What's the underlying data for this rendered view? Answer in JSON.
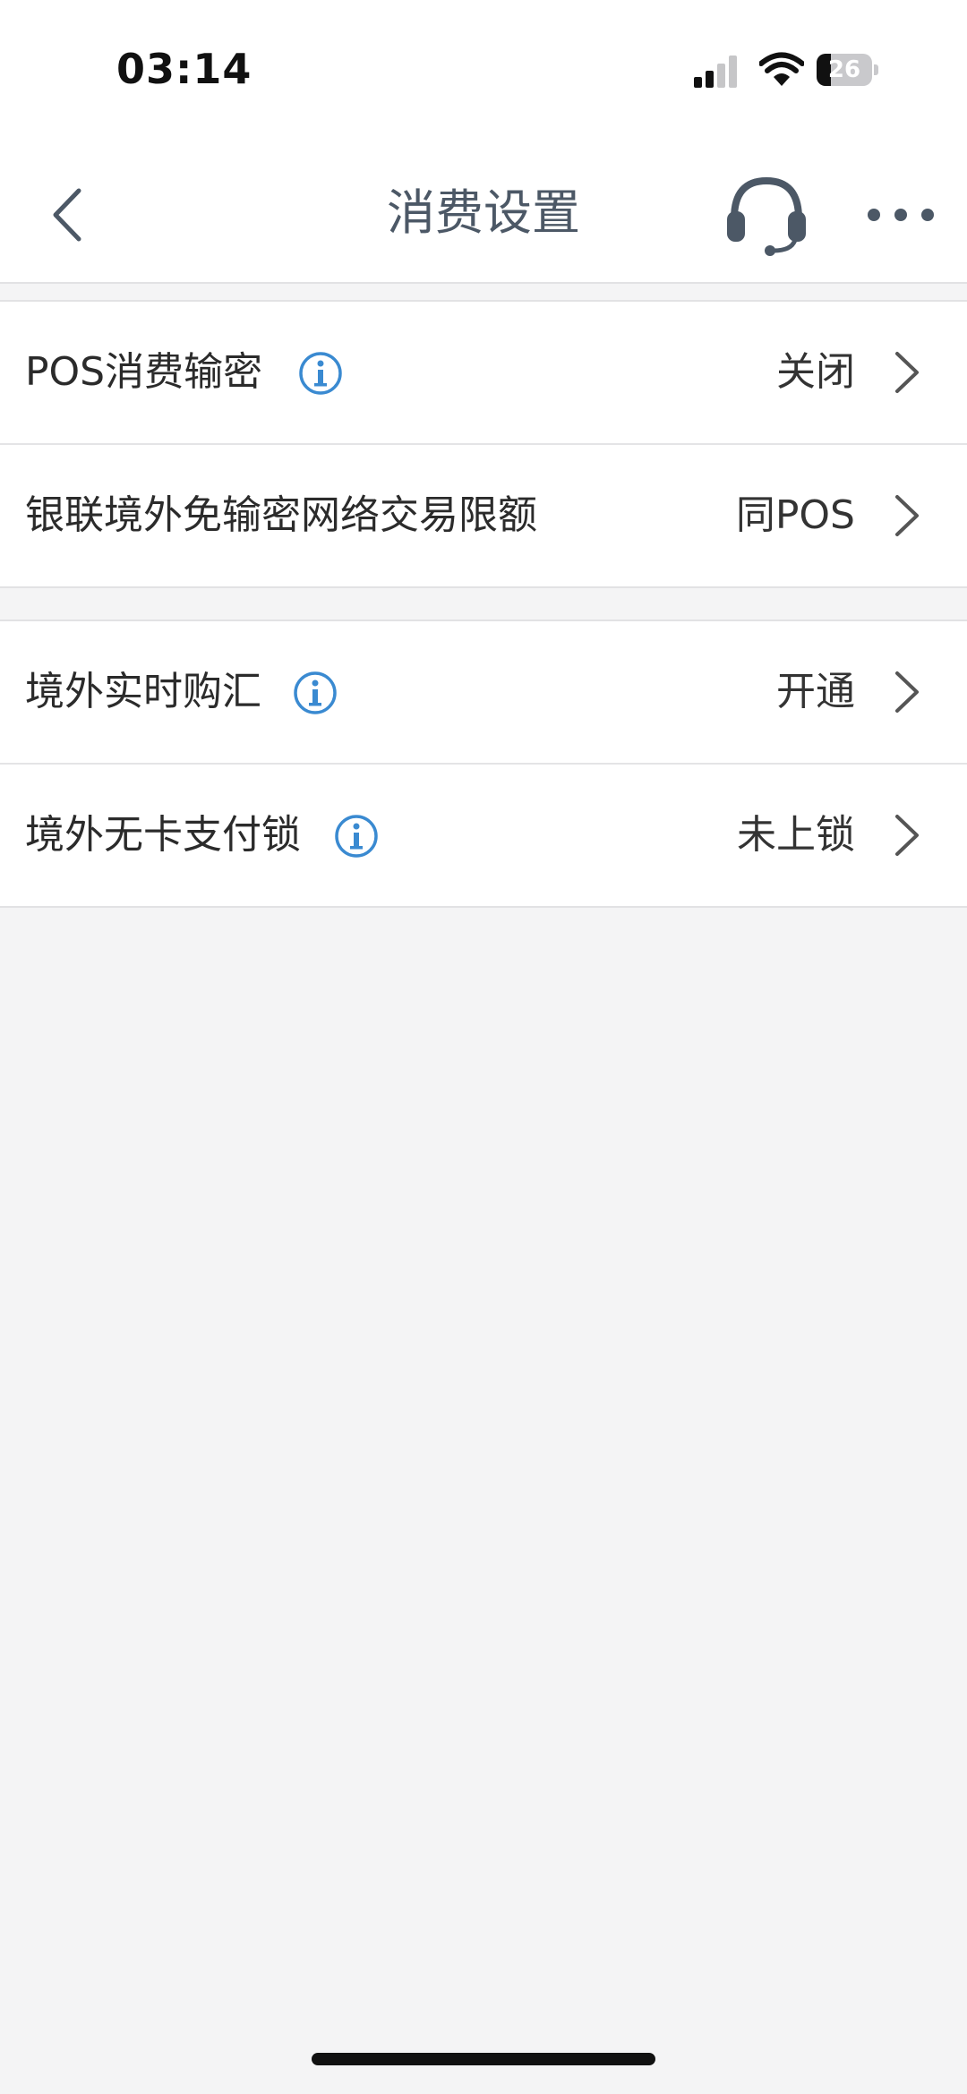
{
  "status_bar": {
    "time": "03:14",
    "battery_level": "26",
    "battery_fraction": 0.26
  },
  "nav": {
    "title": "消费设置",
    "back_icon": "chevron-left-icon",
    "service_icon": "headset-icon",
    "more_icon": "more-dots-icon",
    "icon_color": "#4c5866"
  },
  "groups": [
    {
      "rows": [
        {
          "label": "POS消费输密",
          "has_info": true,
          "value": "关闭"
        },
        {
          "label": "银联境外免输密网络交易限额",
          "has_info": false,
          "value": "同POS"
        }
      ]
    },
    {
      "rows": [
        {
          "label": "境外实时购汇",
          "has_info": true,
          "value": "开通"
        },
        {
          "label": "境外无卡支付锁",
          "has_info": true,
          "value": "未上锁"
        }
      ]
    }
  ],
  "colors": {
    "background": "#f4f4f5",
    "card": "#ffffff",
    "info_icon": "#3a8ad1",
    "chevron": "#555555"
  }
}
